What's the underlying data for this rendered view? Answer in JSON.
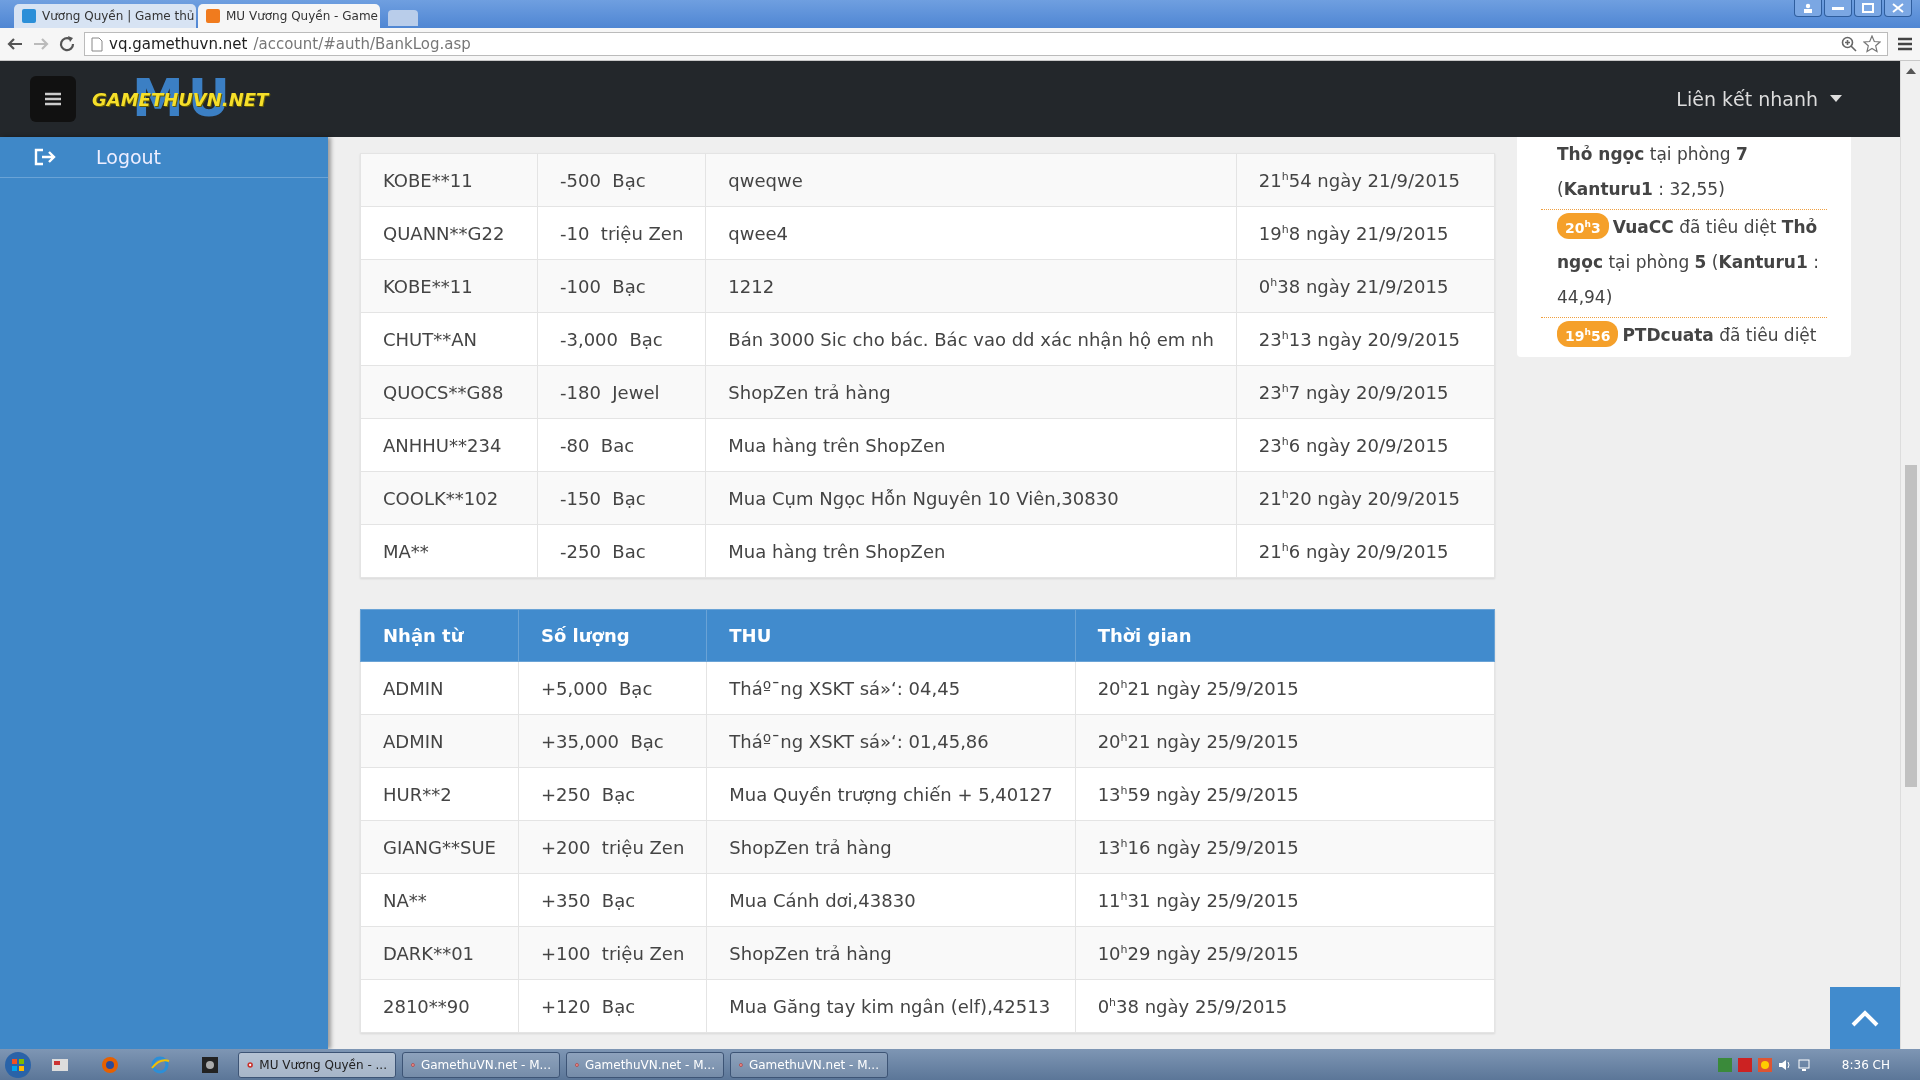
{
  "browser": {
    "tabs": [
      {
        "title": "Vương Quyền | Game thủ",
        "selected": false,
        "color": "#2b8fd8"
      },
      {
        "title": "MU Vương Quyền - Game",
        "selected": true,
        "color": "#f07b1e"
      }
    ],
    "url": {
      "host": "vq.gamethuvn.net",
      "path": "/account/#auth/BankLog.asp"
    }
  },
  "header": {
    "logo_backdrop": "MU",
    "logo_text": "GAMETHUVN.NET",
    "quick_links": "Liên kết nhanh"
  },
  "sidebar": {
    "items": [
      {
        "label": "Logout"
      }
    ]
  },
  "spent_table": {
    "rows": [
      {
        "user": "KOBE**11",
        "amount": "-500  Bạc",
        "note": "qweqwe",
        "time": "21$^{h}$54 ngày 21/9/2015"
      },
      {
        "user": "QUANN**G22",
        "amount": "-10  triệu Zen",
        "note": "qwee4",
        "time": "19$^{h}$8 ngày 21/9/2015"
      },
      {
        "user": "KOBE**11",
        "amount": "-100  Bạc",
        "note": "1212",
        "time": "0$^{h}$38 ngày 21/9/2015"
      },
      {
        "user": "CHUT**AN",
        "amount": "-3,000  Bạc",
        "note": "Bán 3000 Sic cho bác. Bác vao dd xác nhận hộ em nh",
        "time": "23$^{h}$13 ngày 20/9/2015"
      },
      {
        "user": "QUOCS**G88",
        "amount": "-180  Jewel",
        "note": "ShopZen trả hàng",
        "time": "23$^{h}$7 ngày 20/9/2015"
      },
      {
        "user": "ANHHU**234",
        "amount": "-80  Bac",
        "note": "Mua hàng trên ShopZen",
        "time": "23$^{h}$6 ngày 20/9/2015"
      },
      {
        "user": "COOLK**102",
        "amount": "-150  Bạc",
        "note": "Mua Cụm Ngọc Hỗn Nguyên 10 Viên,30830",
        "time": "21$^{h}$20 ngày 20/9/2015"
      },
      {
        "user": "MA**",
        "amount": "-250  Bac",
        "note": "Mua hàng trên ShopZen",
        "time": "21$^{h}$6 ngày 20/9/2015"
      }
    ]
  },
  "received_table": {
    "columns": [
      "Nhận từ",
      "Số lượng",
      "THU",
      "Thời gian"
    ],
    "rows": [
      {
        "user": "ADMIN",
        "amount": "+5,000  Bạc",
        "note": "Tháº¯ng XSKT sá»‘: 04,45",
        "time": "20$^{h}$21 ngày 25/9/2015"
      },
      {
        "user": "ADMIN",
        "amount": "+35,000  Bạc",
        "note": "Tháº¯ng XSKT sá»‘: 01,45,86",
        "time": "20$^{h}$21 ngày 25/9/2015"
      },
      {
        "user": "HUR**2",
        "amount": "+250  Bạc",
        "note": "Mua Quyền trượng chiến + 5,40127",
        "time": "13$^{h}$59 ngày 25/9/2015"
      },
      {
        "user": "GIANG**SUE",
        "amount": "+200  triệu Zen",
        "note": "ShopZen trả hàng",
        "time": "13$^{h}$16 ngày 25/9/2015"
      },
      {
        "user": "NA**",
        "amount": "+350  Bạc",
        "note": "Mua Cánh dơi,43830",
        "time": "11$^{h}$31 ngày 25/9/2015"
      },
      {
        "user": "DARK**01",
        "amount": "+100  triệu Zen",
        "note": "ShopZen trả hàng",
        "time": "10$^{h}$29 ngày 25/9/2015"
      },
      {
        "user": "2810**90",
        "amount": "+120  Bạc",
        "note": "Mua Găng tay kim ngân (elf),42513",
        "time": "0$^{h}$38 ngày 25/9/2015"
      }
    ]
  },
  "feed": {
    "items": [
      {
        "text": "**Thỏ ngọc** tại phòng **7** (**Kanturu1** : 32,55)"
      },
      {
        "time": "20$^{h}$3",
        "text": "**VuaCC** đã tiêu diệt **Thỏ ngọc** tại phòng **5** (**Kanturu1** : 44,94)"
      },
      {
        "time": "19$^{h}$56",
        "text": "**PTDcuata** đã tiêu diệt"
      }
    ]
  },
  "taskbar": {
    "items": [
      {
        "label": "MU Vương Quyền - ...",
        "selected": true
      },
      {
        "label": "GamethuVN.net - M...",
        "selected": false
      },
      {
        "label": "GamethuVN.net - M...",
        "selected": false
      },
      {
        "label": "GamethuVN.net - M...",
        "selected": false
      }
    ],
    "clock": "8:36 CH"
  }
}
